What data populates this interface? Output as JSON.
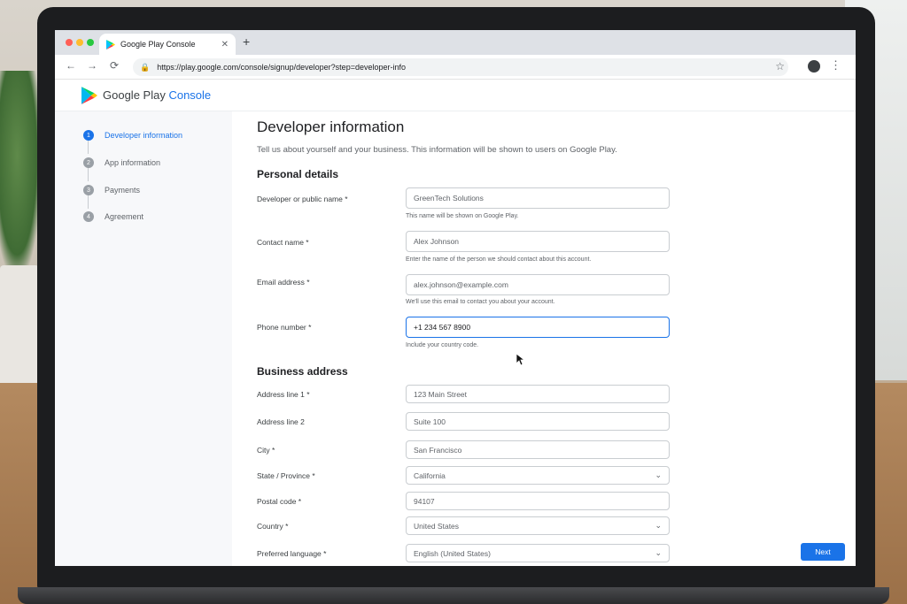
{
  "browser": {
    "tab_title": "Google Play Console",
    "url": "https://play.google.com/console/signup/developer?step=developer-info"
  },
  "brand": {
    "prefix": "Google Play",
    "suffix": "Console"
  },
  "steps": [
    {
      "num": "1",
      "label": "Developer information"
    },
    {
      "num": "2",
      "label": "App information"
    },
    {
      "num": "3",
      "label": "Payments"
    },
    {
      "num": "4",
      "label": "Agreement"
    }
  ],
  "page": {
    "title": "Developer information",
    "subtitle": "Tell us about yourself and your business. This information will be shown to users on Google Play."
  },
  "personal": {
    "heading": "Personal details",
    "dev_name": {
      "label": "Developer or public name *",
      "value": "GreenTech Solutions",
      "helper": "This name will be shown on Google Play."
    },
    "contact": {
      "label": "Contact name *",
      "value": "Alex Johnson",
      "helper": "Enter the name of the person we should contact about this account."
    },
    "email": {
      "label": "Email address *",
      "value": "alex.johnson@example.com",
      "helper": "We'll use this email to contact you about your account."
    },
    "phone": {
      "label": "Phone number *",
      "value": "+1 234 567 8900",
      "helper": "Include your country code."
    }
  },
  "business": {
    "heading": "Business address",
    "addr1": {
      "label": "Address line 1 *",
      "value": "123 Main Street"
    },
    "addr2": {
      "label": "Address line 2",
      "value": "Suite 100"
    },
    "city": {
      "label": "City *",
      "value": "San Francisco"
    },
    "state": {
      "label": "State / Province *",
      "value": "California"
    },
    "postal": {
      "label": "Postal code *",
      "value": "94107"
    },
    "country": {
      "label": "Country *",
      "value": "United States"
    },
    "language": {
      "label": "Preferred language *",
      "value": "English (United States)"
    }
  },
  "actions": {
    "next": "Next"
  },
  "icons": {
    "back": "←",
    "forward": "→",
    "reload": "⟳",
    "lock": "🔒",
    "star": "☆",
    "menu": "⋮",
    "close": "✕",
    "plus": "+",
    "chevron": "⌄"
  },
  "colors": {
    "accent": "#1a73e8",
    "text": "#202124",
    "muted": "#5f6368"
  }
}
